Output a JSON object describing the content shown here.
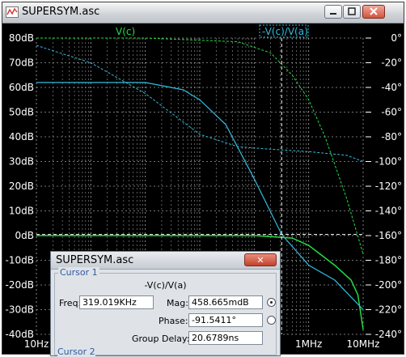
{
  "window": {
    "title": "SUPERSYM.asc"
  },
  "traces": {
    "trace1": "V(c)",
    "trace2": "-V(c)/V(a)"
  },
  "colors": {
    "green": "#22dd44",
    "cyan": "#33bbdd",
    "grid": "#9a9a9a",
    "axis_text": "#ffffff"
  },
  "y_left_ticks": [
    "80dB",
    "70dB",
    "60dB",
    "50dB",
    "40dB",
    "30dB",
    "20dB",
    "10dB",
    "0dB",
    "-10dB",
    "-20dB",
    "-30dB",
    "-40dB"
  ],
  "y_right_ticks": [
    "0°",
    "-20°",
    "-40°",
    "-60°",
    "-80°",
    "-100°",
    "-120°",
    "-140°",
    "-160°",
    "-180°",
    "-200°",
    "-220°",
    "-240°"
  ],
  "x_ticks": {
    "start": "10Hz",
    "mhz1": "1MHz",
    "mhz10": "10MHz"
  },
  "dialog": {
    "title": "SUPERSYM.asc",
    "close": "✕",
    "group1": "Cursor 1",
    "group2": "Cursor 2",
    "trace": "-V(c)/V(a)",
    "freq_label": "Freq:",
    "freq_value": "319.019KHz",
    "mag_label": "Mag:",
    "mag_value": "458.665mdB",
    "phase_label": "Phase:",
    "phase_value": "-91.5411°",
    "gd_label": "Group Delay:",
    "gd_value": "20.6789ns"
  },
  "chart_data": {
    "type": "line",
    "xlabel": "",
    "ylabel": "",
    "x_scale": "log",
    "xlim": [
      "10Hz",
      "10MHz"
    ],
    "ylim": [
      -40,
      80
    ],
    "y2lim": [
      -240,
      0
    ],
    "series": [
      {
        "name": "V(c)",
        "quantity": "magnitude (dB)",
        "freq_hz": [
          10,
          1000,
          100000,
          500000,
          1000000,
          3000000,
          6000000,
          8000000,
          10000000
        ],
        "values": [
          0,
          0,
          0,
          -1,
          -4,
          -12,
          -18,
          -24,
          -38
        ]
      },
      {
        "name": "V(c)",
        "quantity": "phase (°)",
        "freq_hz": [
          10,
          1000,
          50000,
          200000,
          500000,
          1000000,
          2000000,
          5000000,
          10000000
        ],
        "values": [
          0,
          0,
          -3,
          -12,
          -30,
          -50,
          -80,
          -130,
          -175
        ]
      },
      {
        "name": "-V(c)/V(a)",
        "quantity": "magnitude (dB)",
        "freq_hz": [
          10,
          100,
          1000,
          5000,
          10000,
          30000,
          100000,
          319019,
          1000000,
          3000000,
          10000000
        ],
        "values": [
          62,
          62,
          62,
          59,
          55,
          45,
          23,
          0.46,
          -12,
          -18,
          -30
        ]
      },
      {
        "name": "-V(c)/V(a)",
        "quantity": "phase (°)",
        "freq_hz": [
          10,
          100,
          1000,
          10000,
          50000,
          200000,
          1000000,
          5000000,
          10000000
        ],
        "values": [
          -6,
          -20,
          -45,
          -78,
          -88,
          -90,
          -92,
          -95,
          -100
        ]
      }
    ]
  }
}
